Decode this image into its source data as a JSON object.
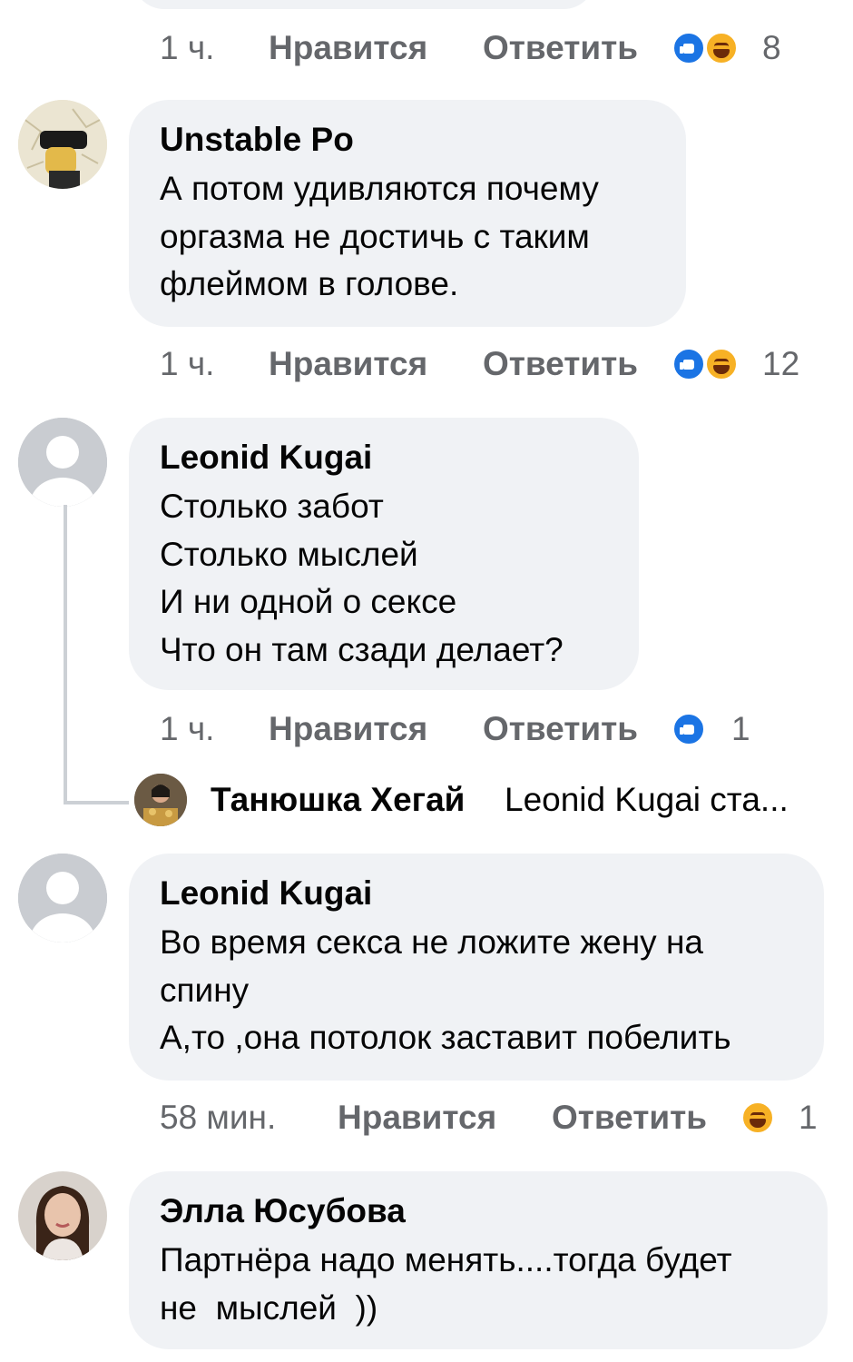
{
  "comments": [
    {
      "meta": {
        "time": "1 ч.",
        "like": "Нравится",
        "reply": "Ответить",
        "reactions": [
          "like-icon",
          "haha-icon"
        ],
        "count": "8"
      }
    },
    {
      "author": "Unstable Po",
      "lines": [
        "А потом удивляются почему",
        "оргазма не достичь с таким",
        "флеймом в голове."
      ],
      "meta": {
        "time": "1 ч.",
        "like": "Нравится",
        "reply": "Ответить",
        "reactions": [
          "like-icon",
          "haha-icon"
        ],
        "count": "12"
      }
    },
    {
      "author": "Leonid Kugai",
      "lines": [
        "Столько забот",
        "Столько мыслей",
        "И ни одной о сексе",
        "Что он там сзади делает?"
      ],
      "meta": {
        "time": "1 ч.",
        "like": "Нравится",
        "reply": "Ответить",
        "reactions": [
          "like-icon"
        ],
        "count": "1"
      },
      "reply_preview": {
        "author": "Танюшка Хегай",
        "text": "Leonid Kugai ста..."
      }
    },
    {
      "author": "Leonid Kugai",
      "lines": [
        "Во время секса не ложите жену на",
        "спину",
        "А,то ,она потолок заставит побелить"
      ],
      "meta": {
        "time": "58 мин.",
        "like": "Нравится",
        "reply": "Ответить",
        "reactions": [
          "haha-icon"
        ],
        "count": "1"
      }
    },
    {
      "author": "Элла Юсубова",
      "lines": [
        "Партнёра надо менять....тогда будет",
        "не  мыслей  ))"
      ]
    }
  ],
  "colors": {
    "bubble": "#f0f2f5",
    "meta_text": "#65676b",
    "like_blue": "#1b74e4",
    "haha_yellow": "#f7b125"
  }
}
